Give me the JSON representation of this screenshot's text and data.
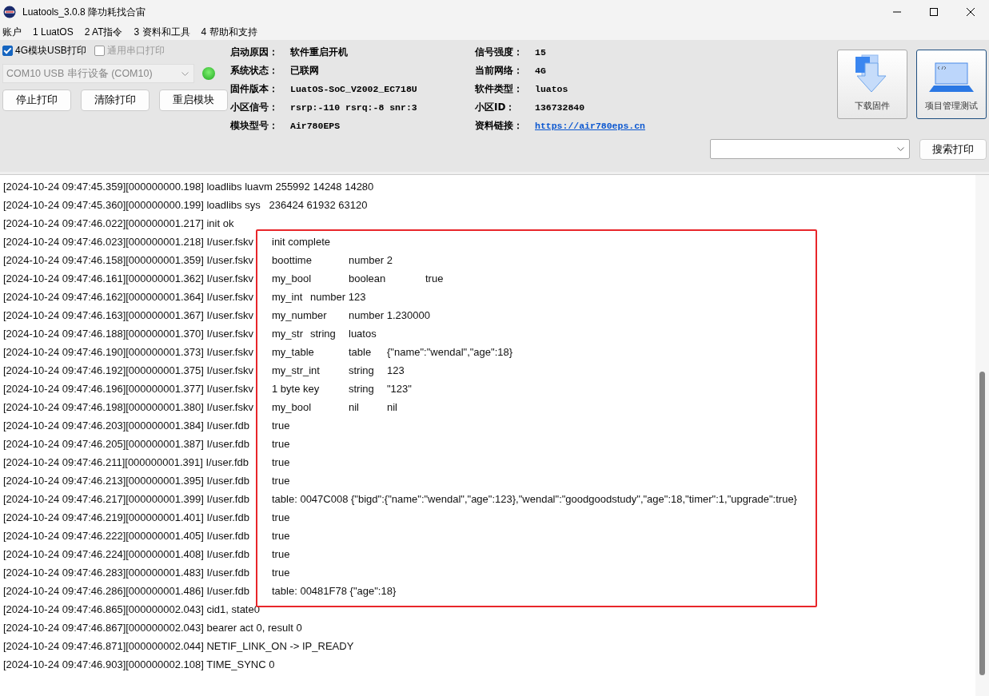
{
  "window": {
    "title": "Luatools_3.0.8 降功耗找合宙"
  },
  "menu": [
    "账户",
    "1 LuatOS",
    "2 AT指令",
    "3 资料和工具",
    "4 帮助和支持"
  ],
  "print_options": [
    {
      "label": "4G模块USB打印",
      "checked": true,
      "disabled": false
    },
    {
      "label": "通用串口打印",
      "checked": false,
      "disabled": true
    }
  ],
  "port": {
    "value": "COM10 USB 串行设备 (COM10)",
    "disabled": true
  },
  "status_led": {
    "on": true
  },
  "actions": [
    "停止打印",
    "清除打印",
    "重启模块"
  ],
  "info_left": [
    {
      "label": "启动原因：",
      "value": "软件重启开机"
    },
    {
      "label": "系统状态：",
      "value": "已联网"
    },
    {
      "label": "固件版本：",
      "value": "LuatOS-SoC_V2002_EC718U"
    },
    {
      "label": "小区信号：",
      "value": "rsrp:-110 rsrq:-8 snr:3"
    },
    {
      "label": "模块型号：",
      "value": "Air780EPS"
    }
  ],
  "info_right": [
    {
      "label": "信号强度：",
      "value": "15",
      "kind": "text"
    },
    {
      "label": "当前网络：",
      "value": "4G",
      "kind": "text"
    },
    {
      "label": "软件类型：",
      "value": "luatos",
      "kind": "text"
    },
    {
      "label": "小区ID：",
      "value": "136732840",
      "kind": "text"
    },
    {
      "label": "资料链接：",
      "value": "https://air780eps.cn",
      "kind": "link"
    }
  ],
  "tool_buttons": [
    {
      "label": "下载固件",
      "kind": "download",
      "focused": false
    },
    {
      "label": "项目管理测试",
      "kind": "laptop",
      "focused": true
    }
  ],
  "search": {
    "button": "搜索打印"
  },
  "log": [
    "[2024-10-24 09:47:45.359][000000000.198] loadlibs luavm 255992 14248 14280",
    "[2024-10-24 09:47:45.360][000000000.199] loadlibs sys   236424 61932 63120",
    "[2024-10-24 09:47:46.022][000000001.217] init ok",
    "[2024-10-24 09:47:46.023][000000001.218] I/user.fskv\tinit complete",
    "[2024-10-24 09:47:46.158][000000001.359] I/user.fskv\tboottime\tnumber 2",
    "[2024-10-24 09:47:46.161][000000001.362] I/user.fskv\tmy_bool\tboolean\ttrue",
    "[2024-10-24 09:47:46.162][000000001.364] I/user.fskv\tmy_int\tnumber 123",
    "[2024-10-24 09:47:46.163][000000001.367] I/user.fskv\tmy_number\tnumber 1.230000",
    "[2024-10-24 09:47:46.188][000000001.370] I/user.fskv\tmy_str\tstring\tluatos",
    "[2024-10-24 09:47:46.190][000000001.373] I/user.fskv\tmy_table\ttable\t{\"name\":\"wendal\",\"age\":18}",
    "[2024-10-24 09:47:46.192][000000001.375] I/user.fskv\tmy_str_int\tstring\t123",
    "[2024-10-24 09:47:46.196][000000001.377] I/user.fskv\t1 byte key\tstring\t\"123\"",
    "[2024-10-24 09:47:46.198][000000001.380] I/user.fskv\tmy_bool\tnil\tnil",
    "[2024-10-24 09:47:46.203][000000001.384] I/user.fdb\ttrue",
    "[2024-10-24 09:47:46.205][000000001.387] I/user.fdb\ttrue",
    "[2024-10-24 09:47:46.211][000000001.391] I/user.fdb\ttrue",
    "[2024-10-24 09:47:46.213][000000001.395] I/user.fdb\ttrue",
    "[2024-10-24 09:47:46.217][000000001.399] I/user.fdb\ttable: 0047C008 {\"bigd\":{\"name\":\"wendal\",\"age\":123},\"wendal\":\"goodgoodstudy\",\"age\":18,\"timer\":1,\"upgrade\":true}",
    "[2024-10-24 09:47:46.219][000000001.401] I/user.fdb\ttrue",
    "[2024-10-24 09:47:46.222][000000001.405] I/user.fdb\ttrue",
    "[2024-10-24 09:47:46.224][000000001.408] I/user.fdb\ttrue",
    "[2024-10-24 09:47:46.283][000000001.483] I/user.fdb\ttrue",
    "[2024-10-24 09:47:46.286][000000001.486] I/user.fdb\ttable: 00481F78 {\"age\":18}",
    "[2024-10-24 09:47:46.865][000000002.043] cid1, state0",
    "[2024-10-24 09:47:46.867][000000002.043] bearer act 0, result 0",
    "[2024-10-24 09:47:46.871][000000002.044] NETIF_LINK_ON -> IP_READY",
    "[2024-10-24 09:47:46.903][000000002.108] TIME_SYNC 0"
  ]
}
